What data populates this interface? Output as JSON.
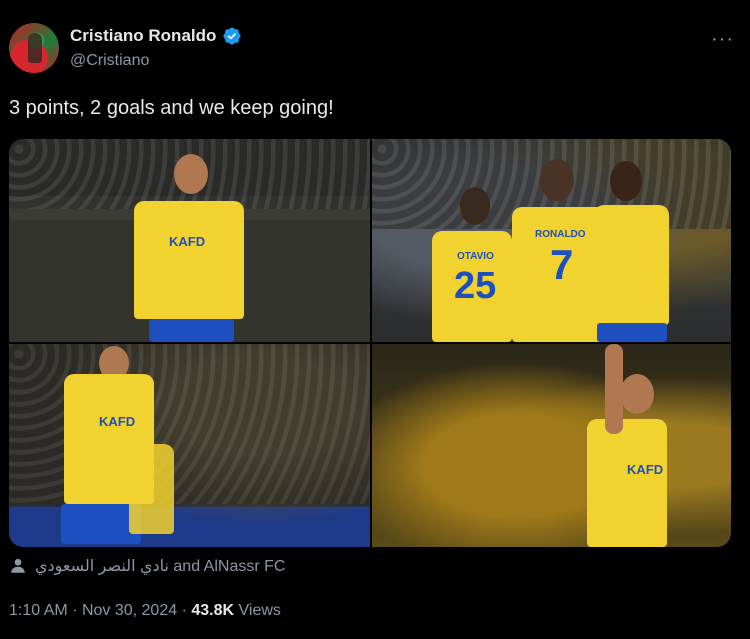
{
  "author": {
    "name": "Cristiano Ronaldo",
    "handle": "@Cristiano",
    "verified_icon": "verified-badge-icon"
  },
  "more_label": "···",
  "tweet": {
    "text": "3 points, 2 goals and we keep going!"
  },
  "media": {
    "photos": [
      {
        "shirt_text": "KAFD"
      },
      {
        "shirt_names": [
          "OTAVIO",
          "RONALDO"
        ],
        "numbers": [
          "25",
          "7"
        ]
      },
      {
        "shirt_text": "KAFD"
      },
      {
        "shirt_text": "KAFD"
      }
    ]
  },
  "tags": {
    "text": "نادي النصر السعودي and AlNassr FC"
  },
  "meta": {
    "time": "1:10 AM",
    "separator": "·",
    "date": "Nov 30, 2024",
    "views_count": "43.8K",
    "views_label": "Views"
  },
  "colors": {
    "background": "#000000",
    "primary_text": "#e7e9ea",
    "secondary_text": "#8b98a5",
    "verified": "#1d9bf0",
    "kit_yellow": "#f2d22e",
    "kit_blue": "#1d4fbf"
  }
}
